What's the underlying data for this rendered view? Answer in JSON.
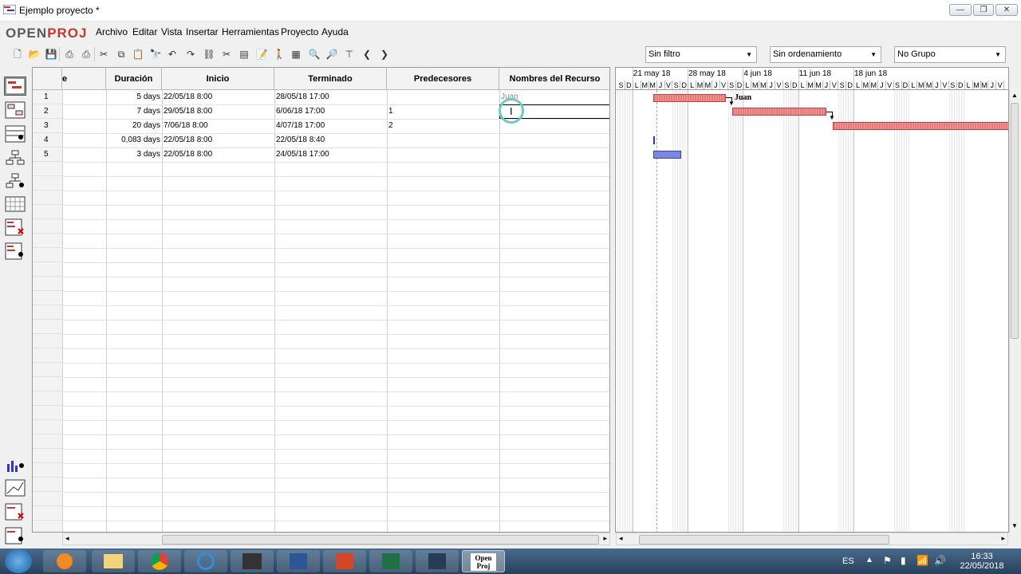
{
  "window": {
    "title": "Ejemplo proyecto *"
  },
  "logo": {
    "text_open": "OPEN",
    "text_proj": "PROJ"
  },
  "menu": [
    "Archivo",
    "Editar",
    "Vista",
    "Insertar",
    "Herramientas",
    "Proyecto",
    "Ayuda"
  ],
  "filters": {
    "filter": "Sin filtro",
    "sort": "Sin ordenamiento",
    "group": "No Grupo"
  },
  "table": {
    "headers": {
      "name": "e",
      "duration": "Duración",
      "start": "Inicio",
      "end": "Terminado",
      "pred": "Predecesores",
      "resources": "Nombres del Recurso"
    },
    "rows": [
      {
        "id": "1",
        "duration": "5 days",
        "start": "22/05/18 8:00",
        "end": "28/05/18 17:00",
        "pred": "",
        "res": "Juan"
      },
      {
        "id": "2",
        "duration": "7 days",
        "start": "29/05/18 8:00",
        "end": "6/06/18 17:00",
        "pred": "1",
        "res": ""
      },
      {
        "id": "3",
        "duration": "20 days",
        "start": "7/06/18 8:00",
        "end": "4/07/18 17:00",
        "pred": "2",
        "res": ""
      },
      {
        "id": "4",
        "duration": "0,083 days",
        "start": "22/05/18 8:00",
        "end": "22/05/18 8:40",
        "pred": "",
        "res": ""
      },
      {
        "id": "5",
        "duration": "3 days",
        "start": "22/05/18 8:00",
        "end": "24/05/18 17:00",
        "pred": "",
        "res": ""
      }
    ]
  },
  "gantt": {
    "weeks": [
      "21 may 18",
      "28 may 18",
      "4 jun 18",
      "11 jun 18",
      "18 jun 18"
    ],
    "days": [
      "S",
      "D",
      "L",
      "M",
      "M",
      "J",
      "V",
      "S",
      "D",
      "L",
      "M",
      "M",
      "J",
      "V",
      "S",
      "D",
      "L",
      "M",
      "M",
      "J",
      "V",
      "S",
      "D",
      "L",
      "M",
      "M",
      "J",
      "V",
      "S",
      "D",
      "L",
      "M",
      "M",
      "J",
      "V",
      "S",
      "D",
      "L",
      "M",
      "M",
      "J",
      "V",
      "S",
      "D",
      "L",
      "M",
      "M",
      "J",
      "V"
    ],
    "bar_label": "Juan"
  },
  "taskbar": {
    "lang": "ES",
    "time": "16:33",
    "date": "22/05/2018",
    "openproj_label_1": "Open",
    "openproj_label_2": "Proj"
  },
  "colors": {
    "task_bar": "#ef9a9a",
    "summary_bar": "#7b87e3",
    "accent": "#c0392b"
  }
}
